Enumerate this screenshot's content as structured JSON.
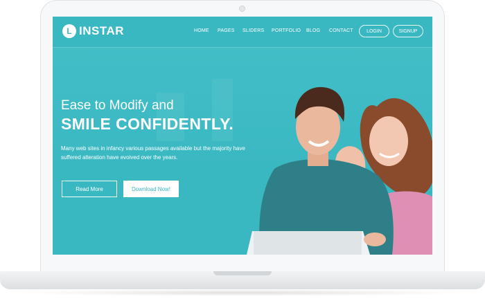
{
  "logo": {
    "letter": "L",
    "name": "INSTAR"
  },
  "nav": {
    "links": [
      "HOME",
      "PAGES",
      "SLIDERS",
      "PORTFOLIO",
      "BLOG",
      "CONTACT"
    ],
    "login_label": "LOGIN",
    "signup_label": "SIGNUP"
  },
  "hero": {
    "line1": "Ease to Modify and",
    "line2": "SMILE CONFIDENTLY.",
    "description": "Many web sites in infancy various passages available but the majority have suffered alteration have evolved over the years.",
    "read_more_label": "Read More",
    "download_label": "Download Now!"
  },
  "colors": {
    "accent": "#3ab8c2",
    "text_light": "#ffffff",
    "bezel": "#f7f8f9"
  }
}
